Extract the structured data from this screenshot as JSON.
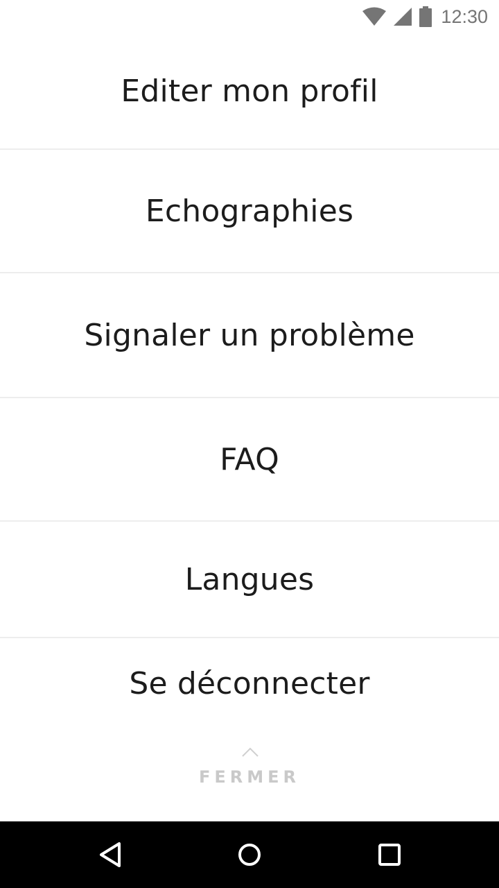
{
  "status_bar": {
    "time": "12:30",
    "icons": [
      "wifi-icon",
      "cell-signal-icon",
      "battery-icon"
    ]
  },
  "menu": {
    "items": [
      {
        "label": "Editer mon profil"
      },
      {
        "label": "Echographies"
      },
      {
        "label": "Signaler un problème"
      },
      {
        "label": "FAQ"
      },
      {
        "label": "Langues"
      },
      {
        "label": "Se déconnecter"
      }
    ]
  },
  "close": {
    "label": "FERMER",
    "icon": "chevron-up-icon"
  },
  "nav_bar": {
    "icons": [
      "back-icon",
      "home-icon",
      "recents-icon"
    ]
  },
  "colors": {
    "text": "#1c1c1c",
    "divider": "#ededed",
    "close_text": "#c9c9c9",
    "status_icon": "#757575",
    "nav_bar": "#000000"
  }
}
